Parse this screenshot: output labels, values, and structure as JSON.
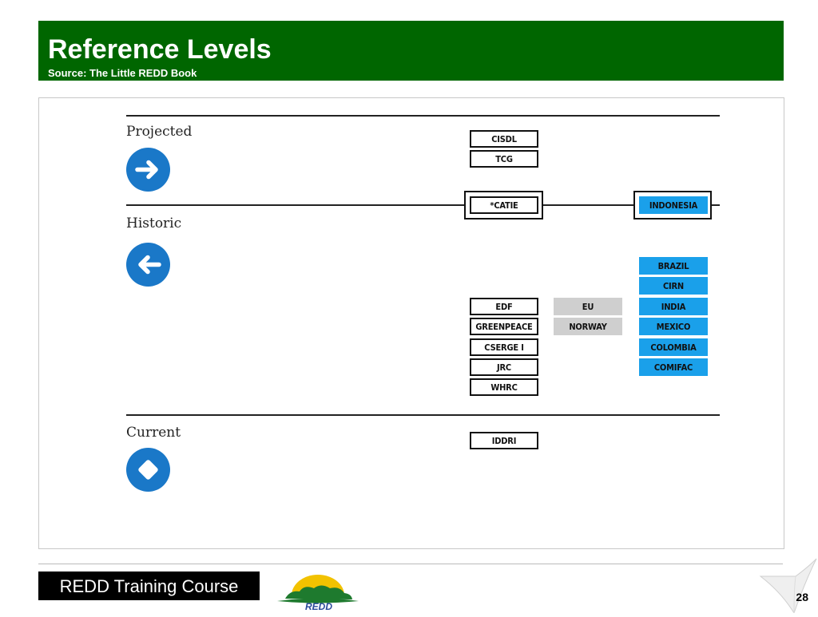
{
  "header": {
    "title": "Reference Levels",
    "subtitle": "Source: The Little REDD Book"
  },
  "sections": {
    "projected": "Projected",
    "historic": "Historic",
    "current": "Current"
  },
  "icons": {
    "projected": "arrow-right-icon",
    "historic": "arrow-left-icon",
    "current": "diamond-icon"
  },
  "boxes": {
    "cisdl": "CISDL",
    "tcg": "TCG",
    "catie": "*CATIE",
    "indonesia": "INDONESIA",
    "edf": "EDF",
    "greenpeace": "GREENPEACE",
    "cserge": "CSERGE I",
    "jrc": "JRC",
    "whrc": "WHRC",
    "eu": "EU",
    "norway": "NORWAY",
    "brazil": "BRAZIL",
    "cirn": "CIRN",
    "india": "INDIA",
    "mexico": "MEXICO",
    "colombia": "COLOMBIA",
    "comifac": "COMIFAC",
    "iddri": "IDDRI"
  },
  "colors": {
    "header_green": "#006600",
    "icon_blue": "#1a78c8",
    "country_blue": "#1aa0ea",
    "donor_grey": "#cfcfcf"
  },
  "footer": {
    "course": "REDD Training Course",
    "logo_text": "REDD",
    "page_number": "28"
  }
}
